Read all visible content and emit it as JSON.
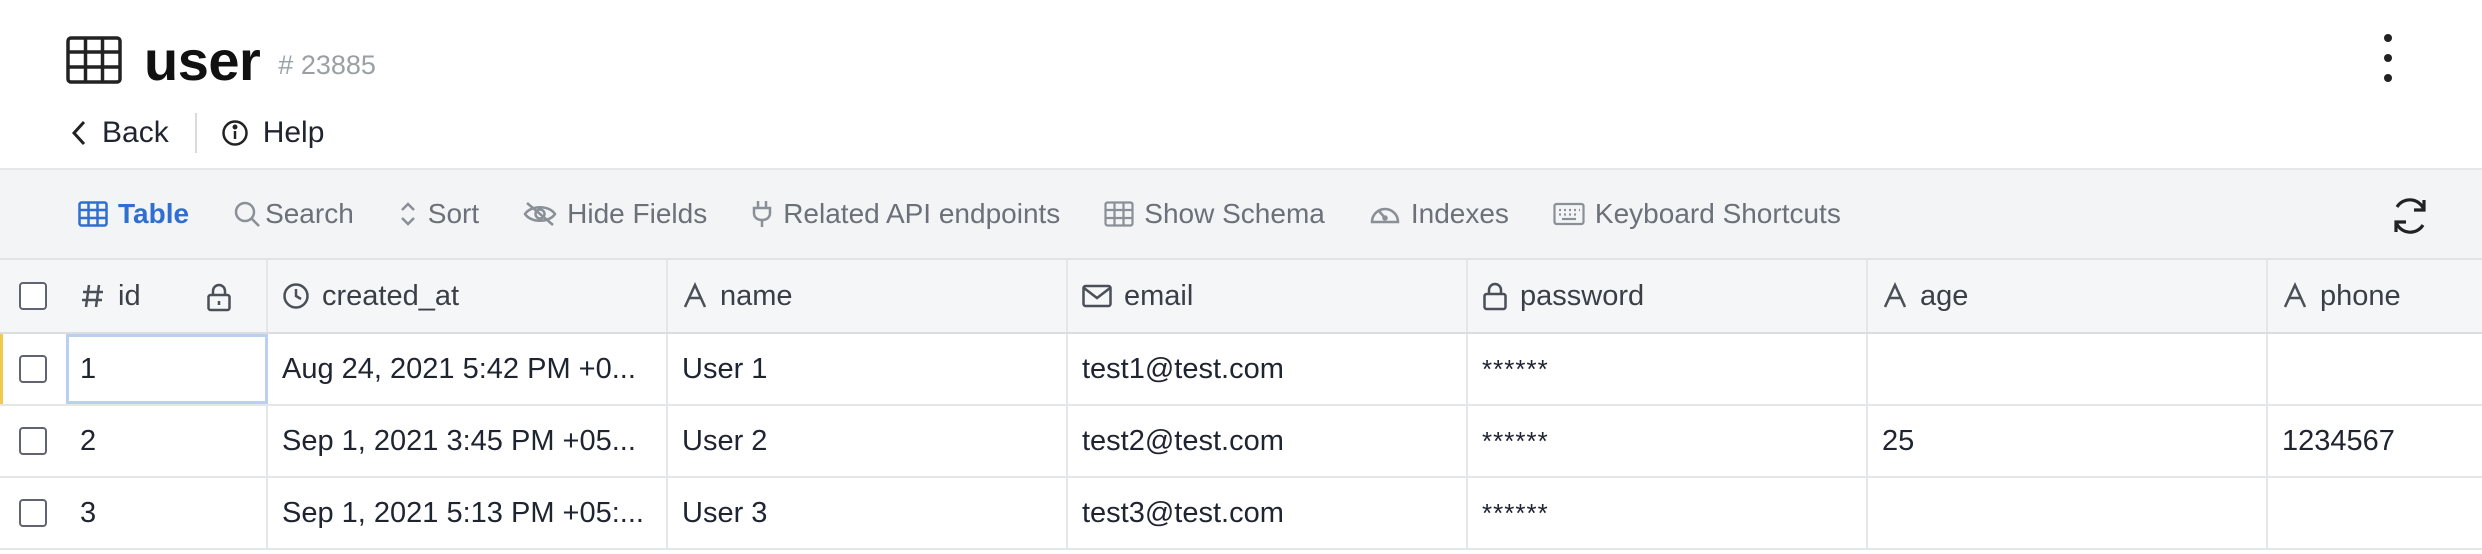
{
  "header": {
    "title": "user",
    "record_id": "# 23885",
    "back_label": "Back",
    "help_label": "Help"
  },
  "toolbar": {
    "items": [
      {
        "label": "Table",
        "icon": "grid-icon",
        "active": true
      },
      {
        "label": "Search",
        "icon": "search-icon"
      },
      {
        "label": "Sort",
        "icon": "sort-icon"
      },
      {
        "label": "Hide Fields",
        "icon": "eye-off-icon"
      },
      {
        "label": "Related API endpoints",
        "icon": "plug-icon"
      },
      {
        "label": "Show Schema",
        "icon": "schema-table-icon"
      },
      {
        "label": "Indexes",
        "icon": "gauge-icon"
      },
      {
        "label": "Keyboard Shortcuts",
        "icon": "keyboard-icon"
      }
    ]
  },
  "table": {
    "columns": [
      {
        "key": "id",
        "label": "id",
        "icon": "hash-icon"
      },
      {
        "key": "created_at",
        "label": "created_at",
        "icon": "clock-icon"
      },
      {
        "key": "name",
        "label": "name",
        "icon": "text-type-icon"
      },
      {
        "key": "email",
        "label": "email",
        "icon": "mail-icon"
      },
      {
        "key": "password",
        "label": "password",
        "icon": "lock-icon"
      },
      {
        "key": "age",
        "label": "age",
        "icon": "text-type-icon"
      },
      {
        "key": "phone",
        "label": "phone",
        "icon": "text-type-icon"
      }
    ],
    "rows": [
      {
        "id": "1",
        "created_at": "Aug 24, 2021 5:42 PM +0...",
        "name": "User 1",
        "email": "test1@test.com",
        "password": "******",
        "age": "",
        "phone": ""
      },
      {
        "id": "2",
        "created_at": "Sep 1, 2021 3:45 PM +05...",
        "name": "User 2",
        "email": "test2@test.com",
        "password": "******",
        "age": "25",
        "phone": "1234567"
      },
      {
        "id": "3",
        "created_at": "Sep 1, 2021 5:13 PM +05:...",
        "name": "User 3",
        "email": "test3@test.com",
        "password": "******",
        "age": "",
        "phone": ""
      }
    ]
  },
  "colors": {
    "accent": "#2f6fd1",
    "toolbar_bg": "#f3f4f5",
    "muted_text": "#6b7079"
  }
}
